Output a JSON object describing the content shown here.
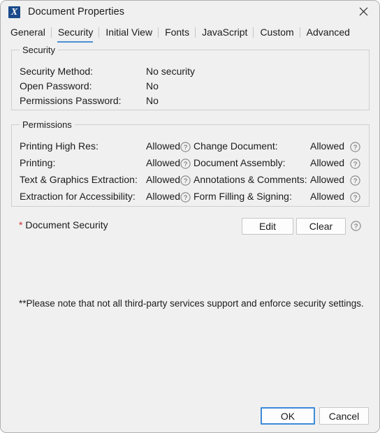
{
  "window": {
    "title": "Document Properties",
    "icon": "pdf-app-icon",
    "icon_glyph": "X",
    "close_icon": "close-icon"
  },
  "tabs": [
    {
      "label": "General",
      "active": false
    },
    {
      "label": "Security",
      "active": true
    },
    {
      "label": "Initial View",
      "active": false
    },
    {
      "label": "Fonts",
      "active": false
    },
    {
      "label": "JavaScript",
      "active": false
    },
    {
      "label": "Custom",
      "active": false
    },
    {
      "label": "Advanced",
      "active": false
    }
  ],
  "security_group": {
    "legend": "Security",
    "rows": [
      {
        "label": "Security Method:",
        "value": "No security"
      },
      {
        "label": "Open Password:",
        "value": "No"
      },
      {
        "label": "Permissions Password:",
        "value": "No"
      }
    ]
  },
  "permissions_group": {
    "legend": "Permissions",
    "left_rows": [
      {
        "label": "Printing High Res:",
        "value": "Allowed",
        "help": "help-icon"
      },
      {
        "label": "Printing:",
        "value": "Allowed",
        "help": "help-icon"
      },
      {
        "label": "Text & Graphics Extraction:",
        "value": "Allowed",
        "help": "help-icon"
      },
      {
        "label": "Extraction for Accessibility:",
        "value": "Allowed",
        "help": "help-icon"
      }
    ],
    "right_rows": [
      {
        "label": "Change Document:",
        "value": "Allowed",
        "help": "help-icon"
      },
      {
        "label": "Document Assembly:",
        "value": "Allowed",
        "help": "help-icon"
      },
      {
        "label": "Annotations & Comments:",
        "value": "Allowed",
        "help": "help-icon"
      },
      {
        "label": "Form Filling & Signing:",
        "value": "Allowed",
        "help": "help-icon"
      }
    ]
  },
  "document_security": {
    "asterisk": "*",
    "label": "Document Security",
    "edit_label": "Edit",
    "clear_label": "Clear",
    "help": "help-icon"
  },
  "note": "**Please note that not all third-party services support and enforce security settings.",
  "footer": {
    "ok_label": "OK",
    "cancel_label": "Cancel"
  },
  "colors": {
    "accent": "#4a8fd4",
    "focus_border": "#3c8ad9",
    "dialog_bg": "#f0f0f0",
    "text": "#1b1b1b",
    "asterisk_red": "#d03030",
    "group_border": "#cfcfcf",
    "icon_blue": "#1a4a8a"
  }
}
